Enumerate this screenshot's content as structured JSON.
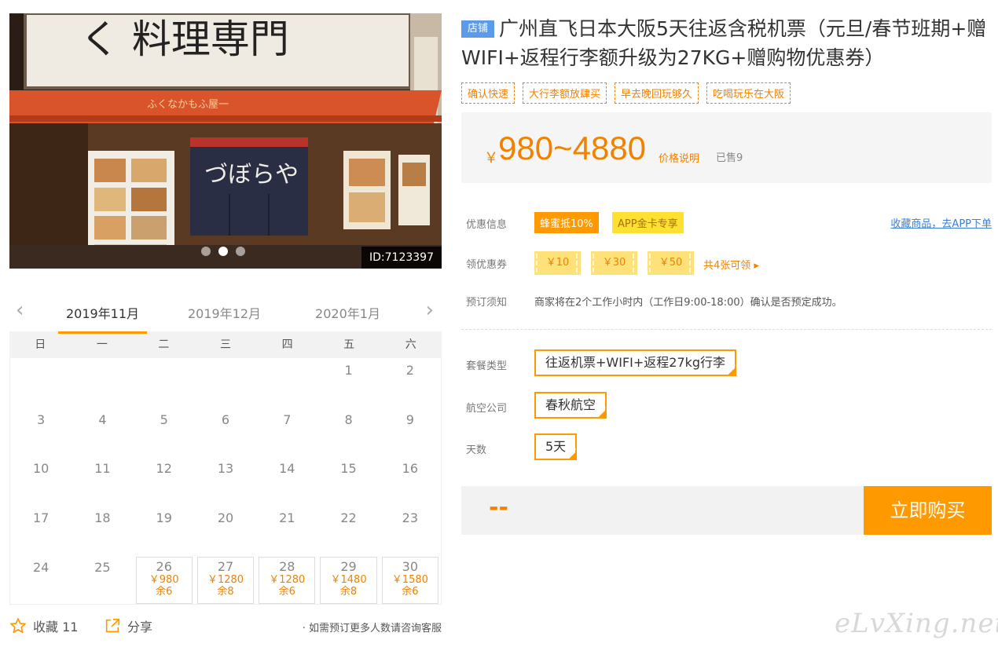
{
  "photo": {
    "id_label": "ID:7123397",
    "dots": 3,
    "active_dot": 1
  },
  "calendar": {
    "prev_icon": "chevron-left-icon",
    "next_icon": "chevron-right-icon",
    "months": [
      "2019年11月",
      "2019年12月",
      "2020年1月"
    ],
    "selected_month": 0,
    "weekdays": [
      "日",
      "一",
      "二",
      "三",
      "四",
      "五",
      "六"
    ],
    "leading_blanks": 5,
    "days": [
      {
        "d": "1"
      },
      {
        "d": "2"
      },
      {
        "d": "3"
      },
      {
        "d": "4"
      },
      {
        "d": "5"
      },
      {
        "d": "6"
      },
      {
        "d": "7"
      },
      {
        "d": "8"
      },
      {
        "d": "9"
      },
      {
        "d": "10"
      },
      {
        "d": "11"
      },
      {
        "d": "12"
      },
      {
        "d": "13"
      },
      {
        "d": "14"
      },
      {
        "d": "15"
      },
      {
        "d": "16"
      },
      {
        "d": "17"
      },
      {
        "d": "18"
      },
      {
        "d": "19"
      },
      {
        "d": "20"
      },
      {
        "d": "21"
      },
      {
        "d": "22"
      },
      {
        "d": "23"
      },
      {
        "d": "24"
      },
      {
        "d": "25"
      },
      {
        "d": "26",
        "price": "￥980",
        "stock": "余6"
      },
      {
        "d": "27",
        "price": "￥1280",
        "stock": "余8"
      },
      {
        "d": "28",
        "price": "￥1280",
        "stock": "余6"
      },
      {
        "d": "29",
        "price": "￥1480",
        "stock": "余8"
      },
      {
        "d": "30",
        "price": "￥1580",
        "stock": "余6"
      }
    ]
  },
  "actions": {
    "fav_icon": "star-icon",
    "fav_label": "收藏 11",
    "share_icon": "share-icon",
    "share_label": "分享",
    "note": "· 如需预订更多人数请咨询客服"
  },
  "product": {
    "shop_badge": "店铺",
    "title": "广州直飞日本大阪5天往返含税机票（元旦/春节班期+赠WIFI+返程行李额升级为27KG+赠购物优惠券）",
    "tags": [
      "确认快速",
      "大行李额放肆买",
      "早去晚回玩够久",
      "吃喝玩乐在大阪"
    ]
  },
  "price": {
    "currency": "￥",
    "range": "980~4880",
    "note": "价格说明",
    "sold": "已售9"
  },
  "offers": {
    "label": "优惠信息",
    "bee_badge": "蜂蜜抵10%",
    "app_badge": "APP金卡专享",
    "app_link": "收藏商品，去APP下单"
  },
  "coupons": {
    "label": "领优惠券",
    "items": [
      "￥10",
      "￥30",
      "￥50"
    ],
    "more": "共4张可领 ▸"
  },
  "booking": {
    "label": "预订须知",
    "text": "商家将在2个工作小时内（工作日9:00-18:00）确认是否预定成功。"
  },
  "options": {
    "package_label": "套餐类型",
    "package_value": "往返机票+WIFI+返程27kg行李",
    "airline_label": "航空公司",
    "airline_value": "春秋航空",
    "days_label": "天数",
    "days_value": "5天"
  },
  "buy": {
    "price_placeholder": "--",
    "button": "立即购买"
  },
  "watermark": "eLvXing.net",
  "colors": {
    "accent": "#ff9900",
    "price": "#f08200",
    "link": "#3d7fd8",
    "shop_badge": "#5b9bea"
  }
}
